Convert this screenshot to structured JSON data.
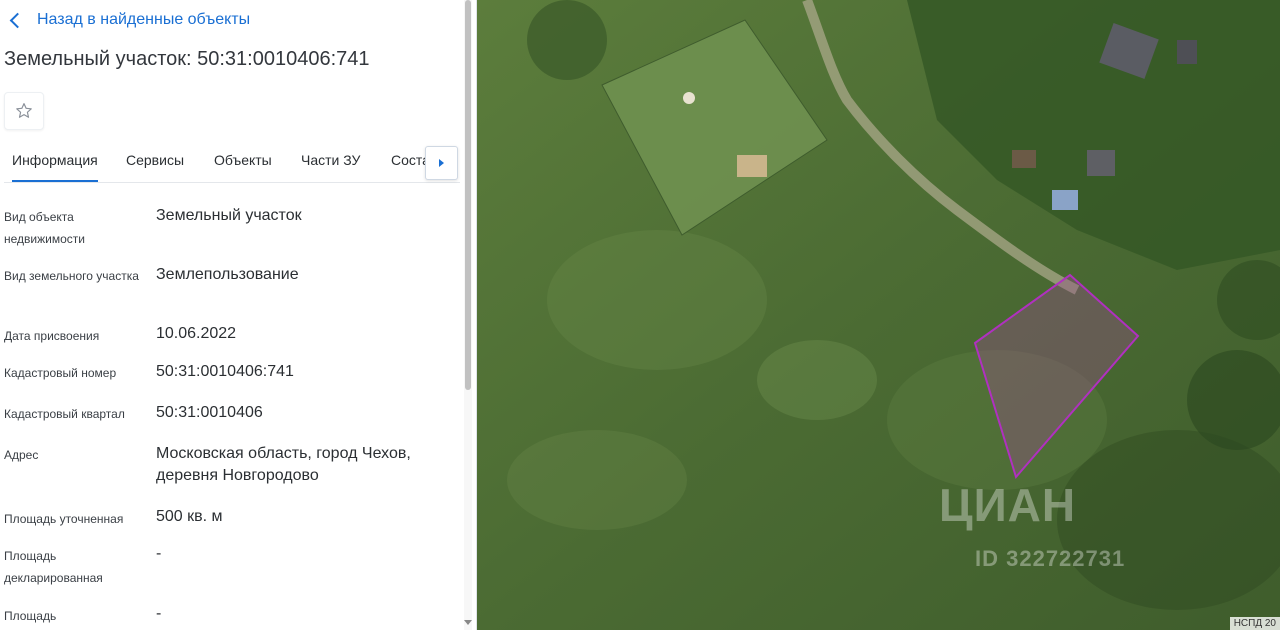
{
  "header": {
    "back_label": "Назад в найденные объекты",
    "title": "Земельный участок: 50:31:0010406:741"
  },
  "tabs": [
    {
      "label": "Информация",
      "active": true
    },
    {
      "label": "Сервисы"
    },
    {
      "label": "Объекты"
    },
    {
      "label": "Части ЗУ"
    },
    {
      "label": "Соста"
    }
  ],
  "properties": [
    {
      "label": "Вид объекта недвижимости",
      "value": "Земельный участок"
    },
    {
      "label": "Вид земельного участка",
      "value": "Землепользование"
    },
    {
      "label": "Дата присвоения",
      "value": "10.06.2022"
    },
    {
      "label": "Кадастровый номер",
      "value": "50:31:0010406:741"
    },
    {
      "label": "Кадастровый квартал",
      "value": "50:31:0010406"
    },
    {
      "label": "Адрес",
      "value": "Московская область, город Чехов, деревня Новгородово"
    },
    {
      "label": "Площадь уточненная",
      "value": "500 кв. м"
    },
    {
      "label": "Площадь декларированная",
      "value": "-"
    },
    {
      "label": "Площадь",
      "value": "-"
    }
  ],
  "map": {
    "watermark": "ЦИАН",
    "watermark_id": "ID 322722731",
    "credit": "НСПД 20",
    "parcel_outline_color": "#b030c0"
  },
  "colors": {
    "accent": "#1a6fd3"
  },
  "icons": {
    "back": "chevron-left-icon",
    "favorite": "star-outline-icon",
    "tabs_next": "caret-right-icon"
  }
}
